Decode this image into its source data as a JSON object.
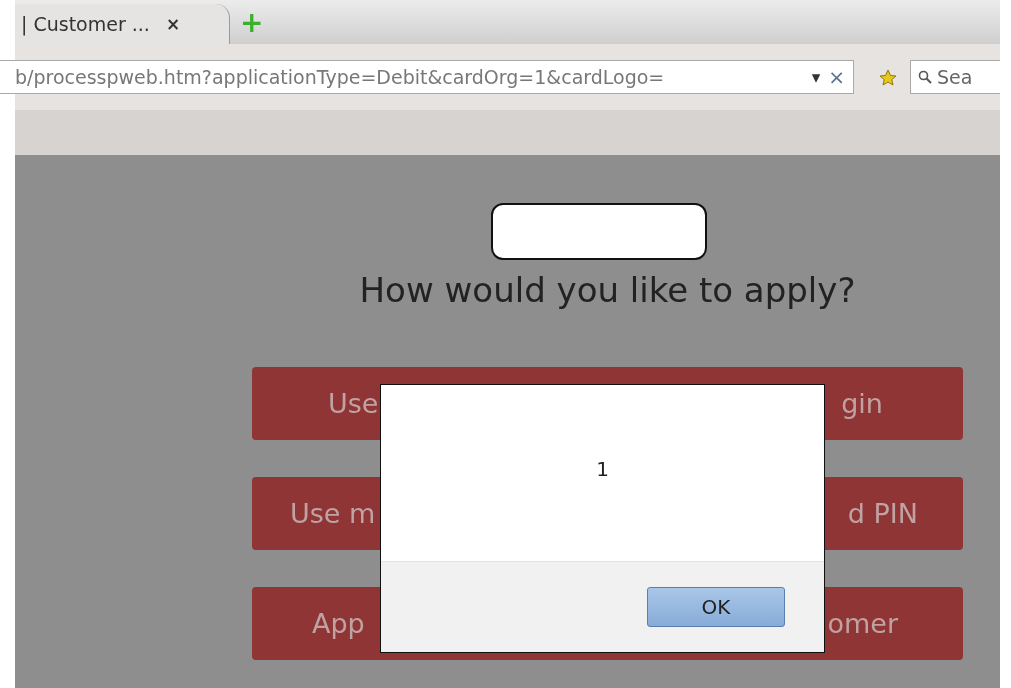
{
  "browser": {
    "tab": {
      "title": "| Customer ...",
      "close": "×",
      "selected": true
    },
    "new_tab": "+",
    "address": "b/processpweb.htm?applicationType=Debit&cardOrg=1&cardLogo=",
    "dropdown": "▾",
    "clear": "×",
    "search": {
      "placeholder": "Sea"
    }
  },
  "page": {
    "heading": "How would you like to apply?",
    "buttons": [
      {
        "visible_start": "Use",
        "visible_end": "gin"
      },
      {
        "visible_start": "Use m",
        "visible_end": "d PIN"
      },
      {
        "visible_start": "App",
        "visible_end": "omer"
      }
    ]
  },
  "dialog": {
    "message": "1",
    "button": "OK"
  }
}
